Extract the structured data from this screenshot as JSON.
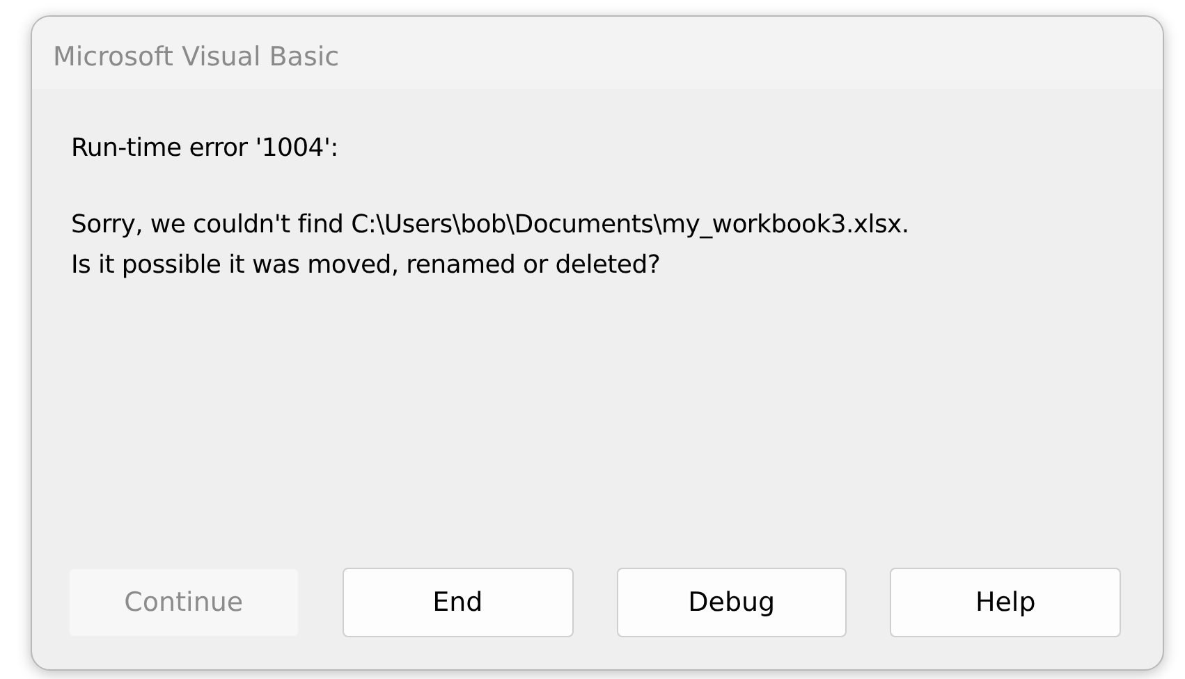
{
  "window": {
    "title": "Microsoft Visual Basic"
  },
  "message": [
    "Run-time error '1004':",
    "Sorry, we couldn't find C:\\Users\\bob\\Documents\\my_workbook3.xlsx.\nIs it possible it was moved, renamed or deleted?"
  ],
  "buttons": [
    {
      "label": "Continue",
      "disabled": true
    },
    {
      "label": "End",
      "disabled": false
    },
    {
      "label": "Debug",
      "disabled": false
    },
    {
      "label": "Help",
      "disabled": false
    }
  ]
}
